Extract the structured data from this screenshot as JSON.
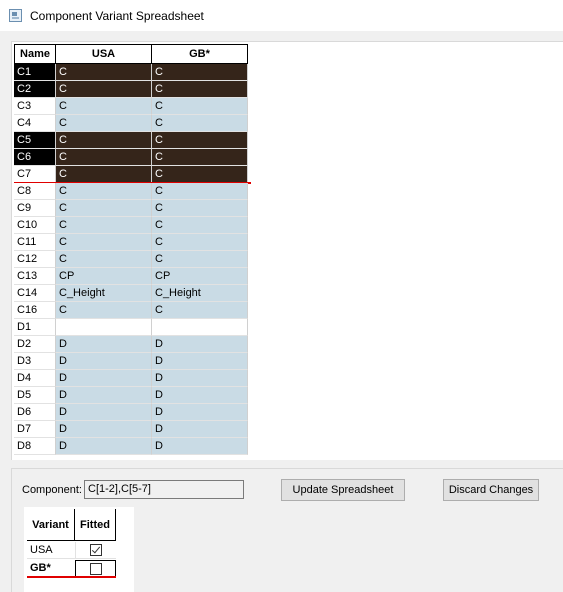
{
  "window": {
    "title": "Component Variant Spreadsheet",
    "icon": "spreadsheet-app-icon"
  },
  "grid": {
    "columns": [
      "Name",
      "USA",
      "GB*"
    ],
    "rows": [
      {
        "name": "C1",
        "usa": "C",
        "gb": "C",
        "state": "selected-name"
      },
      {
        "name": "C2",
        "usa": "C",
        "gb": "C",
        "state": "selected"
      },
      {
        "name": "C3",
        "usa": "C",
        "gb": "C",
        "state": "normal"
      },
      {
        "name": "C4",
        "usa": "C",
        "gb": "C",
        "state": "normal"
      },
      {
        "name": "C5",
        "usa": "C",
        "gb": "C",
        "state": "selected"
      },
      {
        "name": "C6",
        "usa": "C",
        "gb": "C",
        "state": "selected"
      },
      {
        "name": "C7",
        "usa": "C",
        "gb": "C",
        "state": "selected-cells"
      },
      {
        "name": "C8",
        "usa": "C",
        "gb": "C",
        "state": "normal"
      },
      {
        "name": "C9",
        "usa": "C",
        "gb": "C",
        "state": "normal"
      },
      {
        "name": "C10",
        "usa": "C",
        "gb": "C",
        "state": "normal"
      },
      {
        "name": "C11",
        "usa": "C",
        "gb": "C",
        "state": "normal"
      },
      {
        "name": "C12",
        "usa": "C",
        "gb": "C",
        "state": "normal"
      },
      {
        "name": "C13",
        "usa": "CP",
        "gb": "CP",
        "state": "normal"
      },
      {
        "name": "C14",
        "usa": "C_Height",
        "gb": "C_Height",
        "state": "normal"
      },
      {
        "name": "C16",
        "usa": "C",
        "gb": "C",
        "state": "normal"
      },
      {
        "name": "D1",
        "usa": "",
        "gb": "",
        "state": "empty"
      },
      {
        "name": "D2",
        "usa": "D",
        "gb": "D",
        "state": "normal"
      },
      {
        "name": "D3",
        "usa": "D",
        "gb": "D",
        "state": "normal"
      },
      {
        "name": "D4",
        "usa": "D",
        "gb": "D",
        "state": "normal"
      },
      {
        "name": "D5",
        "usa": "D",
        "gb": "D",
        "state": "normal"
      },
      {
        "name": "D6",
        "usa": "D",
        "gb": "D",
        "state": "normal"
      },
      {
        "name": "D7",
        "usa": "D",
        "gb": "D",
        "state": "normal"
      },
      {
        "name": "D8",
        "usa": "D",
        "gb": "D",
        "state": "normal"
      }
    ]
  },
  "component": {
    "label": "Component:",
    "value": "C[1-2],C[5-7]"
  },
  "buttons": {
    "update": "Update Spreadsheet",
    "discard": "Discard Changes"
  },
  "variants": {
    "headers": [
      "Variant",
      "Fitted"
    ],
    "rows": [
      {
        "name": "USA",
        "fitted": true
      },
      {
        "name": "GB*",
        "fitted": false
      }
    ]
  },
  "colors": {
    "cell_bg": "#c9dbe5",
    "selected_cell_bg": "#35251a",
    "selected_name_bg": "#000000",
    "marker_red": "#e00000"
  }
}
